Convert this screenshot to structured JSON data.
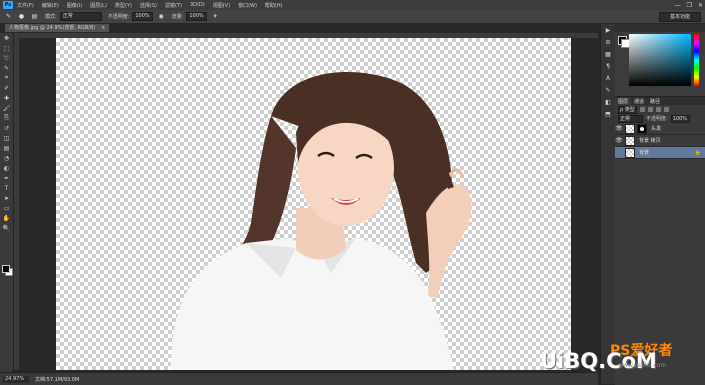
{
  "app": {
    "logo": "Ps"
  },
  "menu": [
    "文件(F)",
    "编辑(E)",
    "图像(I)",
    "图层(L)",
    "类型(Y)",
    "选择(S)",
    "滤镜(T)",
    "3D(D)",
    "视图(V)",
    "窗口(W)",
    "帮助(H)"
  ],
  "window_controls": {
    "minimize": "—",
    "restore": "❐",
    "close": "✕"
  },
  "options": {
    "mode_label": "模式:",
    "mode_value": "正常",
    "opacity_label": "不透明度:",
    "opacity_value": "100%",
    "flow_label": "流量:",
    "flow_value": "100%",
    "workspace": "基本功能"
  },
  "document": {
    "tab_title": "人物抠像.jpg @ 24.9%(背景, RGB/8)",
    "tab_close": "×"
  },
  "status": {
    "zoom": "24.97%",
    "doc_size": "文档:57.1M/93.0M"
  },
  "tools": [
    "move-tool",
    "marquee-tool",
    "lasso-tool",
    "quick-select-tool",
    "crop-tool",
    "eyedropper-tool",
    "healing-tool",
    "brush-tool",
    "clone-tool",
    "history-brush-tool",
    "eraser-tool",
    "gradient-tool",
    "blur-tool",
    "dodge-tool",
    "pen-tool",
    "type-tool",
    "path-select-tool",
    "shape-tool",
    "hand-tool",
    "zoom-tool"
  ],
  "tool_glyphs": [
    "✥",
    "⬚",
    "➰",
    "✎",
    "⌗",
    "✐",
    "✚",
    "🖌",
    "⎘",
    "↺",
    "◫",
    "▤",
    "◔",
    "◐",
    "✒",
    "T",
    "➤",
    "▭",
    "✋",
    "🔍"
  ],
  "dock_icons": [
    "▶",
    "⚙",
    "▦",
    "¶",
    "A",
    "✎",
    "◧",
    "⬒"
  ],
  "colors": {
    "accent": "#31a8ff",
    "selection": "#61799a"
  },
  "layers_panel": {
    "tabs": [
      "图层",
      "通道",
      "路径"
    ],
    "filter_label": "ρ 类型",
    "blend_mode": "正常",
    "opacity_label": "不透明度:",
    "opacity_value": "100%",
    "layers": [
      {
        "name": "头发",
        "visible": true,
        "selected": false,
        "has_mask": true
      },
      {
        "name": "背景 拷贝",
        "visible": true,
        "selected": false,
        "has_mask": false
      },
      {
        "name": "背景",
        "visible": false,
        "selected": true,
        "has_mask": false,
        "locked": true
      }
    ],
    "lock_glyph": "🔒",
    "eye_glyph": "👁"
  },
  "watermark": {
    "text": "UiBQ.CoM",
    "sub": "PS爱好者",
    "url": "www.psahz.com"
  }
}
